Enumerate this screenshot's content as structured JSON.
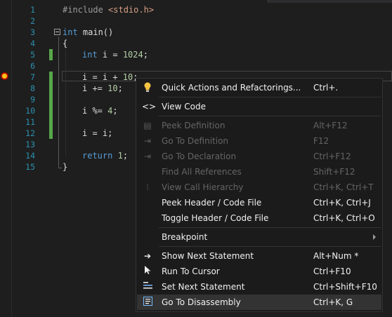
{
  "editor": {
    "line_numbers": [
      "1",
      "2",
      "3",
      "4",
      "5",
      "6",
      "7",
      "8",
      "9",
      "10",
      "11",
      "12",
      "13",
      "14",
      "15"
    ],
    "lines": {
      "l1_pp": "#include",
      "l1_inc": " <stdio.h>",
      "l3_kw": "int",
      "l3_rest": " main()",
      "l4": "{",
      "l5_kw": "int",
      "l5_mid": " i = ",
      "l5_num": "1024",
      "l5_end": ";",
      "l7_a": "i = i + ",
      "l7_num": "10",
      "l7_end": ";",
      "l8_a": "i += ",
      "l8_num": "10",
      "l8_end": ";",
      "l10_a": "i %= ",
      "l10_num": "4",
      "l10_end": ";",
      "l12": "i = i;",
      "l14_kw": "return",
      "l14_sp": " ",
      "l14_num": "1",
      "l14_end": ";",
      "l15": "}"
    },
    "colors": {
      "keyword": "#569cd6",
      "number": "#b5cea8",
      "include": "#d69d85",
      "line_number": "#2b91af",
      "change_bar": "#57a64a"
    }
  },
  "context_menu": {
    "items": [
      {
        "label": "Quick Actions and Refactorings...",
        "shortcut": "Ctrl+.",
        "icon": "lightbulb-icon",
        "enabled": true
      },
      {
        "label": "View Code",
        "shortcut": "",
        "icon": "code-brackets-icon",
        "enabled": true
      },
      {
        "label": "Peek Definition",
        "shortcut": "Alt+F12",
        "icon": "peek-definition-icon",
        "enabled": false
      },
      {
        "label": "Go To Definition",
        "shortcut": "F12",
        "icon": "go-to-definition-icon",
        "enabled": false
      },
      {
        "label": "Go To Declaration",
        "shortcut": "Ctrl+F12",
        "icon": "go-to-declaration-icon",
        "enabled": false
      },
      {
        "label": "Find All References",
        "shortcut": "Shift+F12",
        "icon": "",
        "enabled": false
      },
      {
        "label": "View Call Hierarchy",
        "shortcut": "Ctrl+K, Ctrl+T",
        "icon": "call-hierarchy-icon",
        "enabled": false
      },
      {
        "label": "Peek Header / Code File",
        "shortcut": "Ctrl+K, Ctrl+J",
        "icon": "",
        "enabled": true
      },
      {
        "label": "Toggle Header / Code File",
        "shortcut": "Ctrl+K, Ctrl+O",
        "icon": "",
        "enabled": true
      },
      {
        "label": "Breakpoint",
        "shortcut": "",
        "icon": "",
        "enabled": true,
        "submenu": true
      },
      {
        "label": "Show Next Statement",
        "shortcut": "Alt+Num *",
        "icon": "arrow-right-icon",
        "enabled": true
      },
      {
        "label": "Run To Cursor",
        "shortcut": "Ctrl+F10",
        "icon": "cursor-icon",
        "enabled": true
      },
      {
        "label": "Set Next Statement",
        "shortcut": "Ctrl+Shift+F10",
        "icon": "set-next-statement-icon",
        "enabled": true
      },
      {
        "label": "Go To Disassembly",
        "shortcut": "Ctrl+K, G",
        "icon": "disassembly-icon",
        "enabled": true,
        "highlighted": true
      }
    ]
  }
}
